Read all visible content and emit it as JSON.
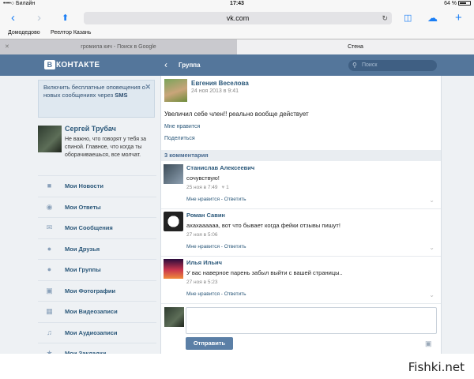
{
  "status": {
    "carrier": "••••○ Билайн",
    "time": "17:43",
    "battery": "64 %"
  },
  "browser": {
    "url": "vk.com",
    "bookmarks": [
      "Домодедово",
      "Реелтор Казань"
    ],
    "tabs": [
      {
        "label": "громила кич - Поиск в Google",
        "active": false
      },
      {
        "label": "Стена",
        "active": true
      }
    ]
  },
  "vk": {
    "logo": "КОНТАКТЕ",
    "logo_box": "В",
    "header_title": "Группа",
    "search_placeholder": "Поиск"
  },
  "sidebar": {
    "notice_text": "Включить бесплатные оповещения о новых сообщениях через",
    "notice_sms": "SMS",
    "user_name": "Сергей Трубач",
    "user_status": "Не важно, что говорят у тебя за спиной. Главное, что когда ты оборачиваешься, все молчат.",
    "menu": [
      {
        "label": "Мои Новости",
        "icon": "news-icon"
      },
      {
        "label": "Мои Ответы",
        "icon": "replies-icon"
      },
      {
        "label": "Мои Сообщения",
        "icon": "messages-icon"
      },
      {
        "label": "Мои Друзья",
        "icon": "friends-icon"
      },
      {
        "label": "Мои Группы",
        "icon": "groups-icon"
      },
      {
        "label": "Мои Фотографии",
        "icon": "camera-icon"
      },
      {
        "label": "Мои Видеозаписи",
        "icon": "film-icon"
      },
      {
        "label": "Мои Аудиозаписи",
        "icon": "music-icon"
      },
      {
        "label": "Мои Закладки",
        "icon": "star-icon"
      }
    ]
  },
  "post": {
    "author": "Евгения Веселова",
    "date": "24 ноя 2013 в 9:41",
    "text": "Увеличил себе член!! реально вообще действует",
    "like": "Мне нравится",
    "share": "Поделиться",
    "comments_header": "3 комментария"
  },
  "comments": [
    {
      "name": "Станислав Алексеевич",
      "text": "сочувствую!",
      "date": "25 ноя в 7:49",
      "likes": "1",
      "actions": "Мне нравится - Ответить"
    },
    {
      "name": "Роман Савин",
      "text": "ахахаааааа, вот что бывает когда фейки отзывы пишут!",
      "date": "27 ноя в 5:06",
      "likes": "",
      "actions": "Мне нравится - Ответить"
    },
    {
      "name": "Илья Ильич",
      "text": "У вас наверное парень забыл выйти с вашей страницы..",
      "date": "27 ноя в 5:23",
      "likes": "",
      "actions": "Мне нравится - Ответить"
    }
  ],
  "reply": {
    "send_label": "Отправить"
  },
  "watermark": "Fishki.net"
}
